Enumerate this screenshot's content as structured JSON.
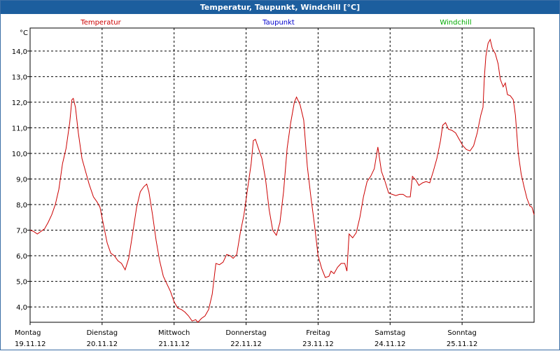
{
  "window": {
    "title": "Temperatur, Taupunkt, Windchill [°C]"
  },
  "legend": [
    {
      "label": "Temperatur",
      "color": "#cc0000"
    },
    {
      "label": "Taupunkt",
      "color": "#0000cc"
    },
    {
      "label": "Windchill",
      "color": "#00aa00"
    }
  ],
  "chart_data": {
    "type": "line",
    "title": "Temperatur, Taupunkt, Windchill [°C]",
    "ylabel": "°C",
    "xlabel": "",
    "ylim": [
      3.4,
      14.9
    ],
    "xlim": [
      0,
      7
    ],
    "y_ticks": [
      4,
      5,
      6,
      7,
      8,
      9,
      10,
      11,
      12,
      13,
      14
    ],
    "y_tick_labels": [
      "4,0",
      "5,0",
      "6,0",
      "7,0",
      "8,0",
      "9,0",
      "10,0",
      "11,0",
      "12,0",
      "13,0",
      "14,0"
    ],
    "x_tick_labels": [
      {
        "day": "Montag",
        "date": "19.11.12"
      },
      {
        "day": "Dienstag",
        "date": "20.11.12"
      },
      {
        "day": "Mittwoch",
        "date": "21.11.12"
      },
      {
        "day": "Donnerstag",
        "date": "22.11.12"
      },
      {
        "day": "Freitag",
        "date": "23.11.12"
      },
      {
        "day": "Samstag",
        "date": "24.11.12"
      },
      {
        "day": "Sonntag",
        "date": "25.11.12"
      }
    ],
    "grid": true,
    "legend_position": "top",
    "series": [
      {
        "name": "Temperatur",
        "color": "#cc0000",
        "points": [
          [
            0.0,
            7.0
          ],
          [
            0.05,
            6.95
          ],
          [
            0.1,
            6.85
          ],
          [
            0.15,
            6.95
          ],
          [
            0.2,
            7.05
          ],
          [
            0.25,
            7.3
          ],
          [
            0.3,
            7.6
          ],
          [
            0.35,
            8.0
          ],
          [
            0.4,
            8.6
          ],
          [
            0.45,
            9.6
          ],
          [
            0.5,
            10.2
          ],
          [
            0.55,
            11.2
          ],
          [
            0.58,
            12.1
          ],
          [
            0.6,
            12.15
          ],
          [
            0.63,
            11.8
          ],
          [
            0.67,
            10.8
          ],
          [
            0.72,
            9.8
          ],
          [
            0.77,
            9.3
          ],
          [
            0.82,
            8.8
          ],
          [
            0.88,
            8.3
          ],
          [
            0.93,
            8.1
          ],
          [
            0.97,
            7.9
          ],
          [
            1.02,
            7.2
          ],
          [
            1.07,
            6.5
          ],
          [
            1.12,
            6.1
          ],
          [
            1.17,
            6.0
          ],
          [
            1.22,
            5.8
          ],
          [
            1.27,
            5.7
          ],
          [
            1.32,
            5.45
          ],
          [
            1.37,
            5.9
          ],
          [
            1.42,
            6.8
          ],
          [
            1.48,
            7.9
          ],
          [
            1.53,
            8.5
          ],
          [
            1.58,
            8.7
          ],
          [
            1.62,
            8.8
          ],
          [
            1.65,
            8.5
          ],
          [
            1.7,
            7.6
          ],
          [
            1.75,
            6.6
          ],
          [
            1.8,
            5.8
          ],
          [
            1.85,
            5.2
          ],
          [
            1.9,
            4.9
          ],
          [
            1.95,
            4.6
          ],
          [
            2.0,
            4.2
          ],
          [
            2.05,
            3.95
          ],
          [
            2.1,
            3.9
          ],
          [
            2.15,
            3.8
          ],
          [
            2.2,
            3.65
          ],
          [
            2.25,
            3.45
          ],
          [
            2.3,
            3.5
          ],
          [
            2.33,
            3.4
          ],
          [
            2.38,
            3.55
          ],
          [
            2.43,
            3.65
          ],
          [
            2.48,
            3.9
          ],
          [
            2.53,
            4.5
          ],
          [
            2.58,
            5.7
          ],
          [
            2.63,
            5.65
          ],
          [
            2.68,
            5.75
          ],
          [
            2.73,
            6.05
          ],
          [
            2.78,
            6.0
          ],
          [
            2.82,
            5.9
          ],
          [
            2.87,
            6.05
          ],
          [
            2.92,
            6.9
          ],
          [
            2.97,
            7.6
          ],
          [
            3.02,
            8.6
          ],
          [
            3.07,
            9.6
          ],
          [
            3.1,
            10.5
          ],
          [
            3.13,
            10.55
          ],
          [
            3.17,
            10.2
          ],
          [
            3.22,
            9.8
          ],
          [
            3.27,
            9.0
          ],
          [
            3.32,
            7.8
          ],
          [
            3.37,
            7.0
          ],
          [
            3.42,
            6.8
          ],
          [
            3.47,
            7.3
          ],
          [
            3.52,
            8.5
          ],
          [
            3.57,
            10.2
          ],
          [
            3.62,
            11.2
          ],
          [
            3.67,
            12.0
          ],
          [
            3.7,
            12.2
          ],
          [
            3.75,
            11.9
          ],
          [
            3.8,
            11.3
          ],
          [
            3.85,
            9.5
          ],
          [
            3.9,
            8.3
          ],
          [
            3.95,
            7.2
          ],
          [
            4.0,
            6.0
          ],
          [
            4.05,
            5.5
          ],
          [
            4.1,
            5.15
          ],
          [
            4.15,
            5.2
          ],
          [
            4.18,
            5.4
          ],
          [
            4.22,
            5.3
          ],
          [
            4.27,
            5.55
          ],
          [
            4.32,
            5.7
          ],
          [
            4.37,
            5.7
          ],
          [
            4.4,
            5.4
          ],
          [
            4.43,
            6.85
          ],
          [
            4.48,
            6.7
          ],
          [
            4.53,
            6.9
          ],
          [
            4.58,
            7.5
          ],
          [
            4.63,
            8.3
          ],
          [
            4.68,
            8.9
          ],
          [
            4.73,
            9.1
          ],
          [
            4.78,
            9.4
          ],
          [
            4.83,
            10.25
          ],
          [
            4.88,
            9.3
          ],
          [
            4.93,
            8.9
          ],
          [
            4.98,
            8.45
          ],
          [
            5.03,
            8.4
          ],
          [
            5.08,
            8.35
          ],
          [
            5.13,
            8.4
          ],
          [
            5.18,
            8.4
          ],
          [
            5.23,
            8.3
          ],
          [
            5.28,
            8.3
          ],
          [
            5.31,
            9.1
          ],
          [
            5.36,
            8.95
          ],
          [
            5.4,
            8.75
          ],
          [
            5.45,
            8.85
          ],
          [
            5.5,
            8.9
          ],
          [
            5.55,
            8.85
          ],
          [
            5.6,
            9.3
          ],
          [
            5.65,
            9.8
          ],
          [
            5.7,
            10.5
          ],
          [
            5.73,
            11.1
          ],
          [
            5.77,
            11.2
          ],
          [
            5.81,
            10.95
          ],
          [
            5.86,
            10.9
          ],
          [
            5.91,
            10.8
          ],
          [
            5.96,
            10.55
          ],
          [
            6.01,
            10.3
          ],
          [
            6.06,
            10.15
          ],
          [
            6.11,
            10.1
          ],
          [
            6.16,
            10.3
          ],
          [
            6.21,
            10.8
          ],
          [
            6.26,
            11.5
          ],
          [
            6.29,
            11.8
          ],
          [
            6.31,
            13.0
          ],
          [
            6.33,
            13.8
          ],
          [
            6.36,
            14.3
          ],
          [
            6.39,
            14.45
          ],
          [
            6.42,
            14.1
          ],
          [
            6.46,
            13.9
          ],
          [
            6.5,
            13.5
          ],
          [
            6.53,
            12.9
          ],
          [
            6.57,
            12.6
          ],
          [
            6.6,
            12.75
          ],
          [
            6.63,
            12.3
          ],
          [
            6.67,
            12.25
          ],
          [
            6.71,
            12.1
          ],
          [
            6.74,
            11.5
          ],
          [
            6.78,
            10.0
          ],
          [
            6.82,
            9.2
          ],
          [
            6.86,
            8.7
          ],
          [
            6.9,
            8.25
          ],
          [
            6.94,
            7.95
          ],
          [
            6.97,
            7.9
          ],
          [
            7.0,
            7.6
          ]
        ]
      }
    ]
  }
}
